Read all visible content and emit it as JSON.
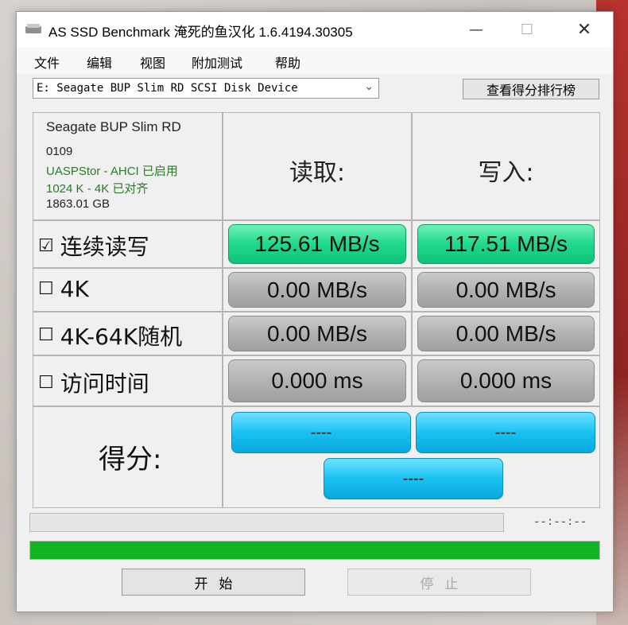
{
  "window": {
    "title": "AS SSD Benchmark 淹死的鱼汉化 1.6.4194.30305"
  },
  "menu": [
    "文件",
    "编辑",
    "视图",
    "附加测试",
    "帮助"
  ],
  "drive": {
    "selected": "E: Seagate BUP Slim RD SCSI Disk Device",
    "rank_button": "查看得分排行榜"
  },
  "device_info": {
    "model": "Seagate BUP Slim RD",
    "firmware": "0109",
    "driver": "UASPStor - AHCI 已启用",
    "alignment": "1024 K - 4K 已对齐",
    "capacity": "1863.01 GB"
  },
  "headers": {
    "read": "读取:",
    "write": "写入:"
  },
  "tests": [
    {
      "check": "☑",
      "label": "连续读写",
      "read": "125.61 MB/s",
      "write": "117.51 MB/s",
      "status": "done"
    },
    {
      "check": "☐",
      "label": "4K",
      "read": "0.00 MB/s",
      "write": "0.00 MB/s",
      "status": "idle"
    },
    {
      "check": "☐",
      "label": "4K-64K随机",
      "read": "0.00 MB/s",
      "write": "0.00 MB/s",
      "status": "idle"
    },
    {
      "check": "☐",
      "label": "访问时间",
      "read": "0.000 ms",
      "write": "0.000 ms",
      "status": "idle"
    }
  ],
  "score": {
    "label": "得分:",
    "read": "----",
    "write": "----",
    "total": "----"
  },
  "progress": {
    "time": "--:--:--",
    "fraction": 1.0
  },
  "buttons": {
    "start": "开始",
    "stop": "停止"
  },
  "colors": {
    "done": "#1fd98d",
    "idle": "#b0b0b0",
    "score": "#18c2f2",
    "progress": "#12b521"
  }
}
